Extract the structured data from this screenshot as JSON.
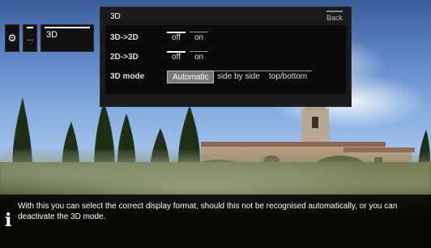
{
  "left_menu": {
    "settings_icon": "gear-icon",
    "dots_label": "...",
    "active_label": "3D"
  },
  "panel": {
    "title": "3D",
    "back_label": "Back",
    "rows": [
      {
        "label": "3D->2D",
        "options": [
          {
            "label": "off",
            "state": "selected"
          },
          {
            "label": "on",
            "state": "normal"
          }
        ]
      },
      {
        "label": "2D->3D",
        "options": [
          {
            "label": "off",
            "state": "selected"
          },
          {
            "label": "on",
            "state": "normal"
          }
        ]
      },
      {
        "label": "3D mode",
        "options": [
          {
            "label": "Automatic",
            "state": "highlight"
          },
          {
            "label": "side by side",
            "state": "normal"
          },
          {
            "label": "top/bottom",
            "state": "normal"
          }
        ]
      }
    ]
  },
  "info_bar": {
    "icon": "info-icon",
    "text": "With this you can select the correct display format, should this not be recognised automatically, or you can deactivate the 3D mode."
  },
  "colors": {
    "panel_bg": "#1b1b1b",
    "panel_inner": "#0b0b0b",
    "highlight": "#7a7a7a",
    "text": "#ffffff"
  }
}
